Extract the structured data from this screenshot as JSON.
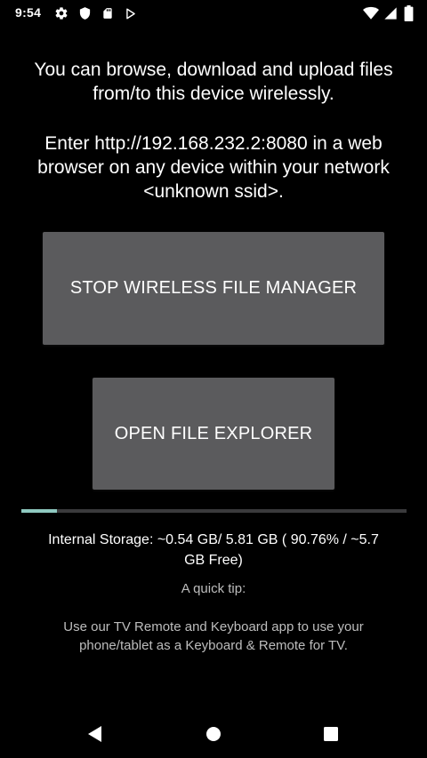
{
  "status_bar": {
    "time": "9:54",
    "left_icons": [
      "settings-gear-icon",
      "shield-icon",
      "sd-card-icon",
      "play-store-icon"
    ],
    "right_icons": [
      "wifi-icon",
      "signal-icon",
      "battery-icon"
    ]
  },
  "info": {
    "line1": "You can browse, download and upload files",
    "line2": "from/to this device wirelessly.",
    "line3": "Enter http://192.168.232.2:8080 in a web",
    "line4": "browser on any device within your network",
    "line5": "<unknown ssid>."
  },
  "buttons": {
    "stop_label": "STOP WIRELESS FILE MANAGER",
    "open_label": "OPEN FILE EXPLORER"
  },
  "storage": {
    "used_fraction": 0.0924,
    "line1": "Internal Storage: ~0.54 GB/ 5.81 GB ( 90.76% / ~5.7",
    "line2": "GB Free)"
  },
  "tip": {
    "title": "A quick tip:",
    "line1": "Use our TV Remote and Keyboard app to use your",
    "line2": "phone/tablet as a Keyboard & Remote for TV."
  },
  "colors": {
    "background": "#000000",
    "button": "#5b5b5d",
    "progress_fill": "#8fc9c0",
    "progress_track": "#3a3a3c"
  }
}
